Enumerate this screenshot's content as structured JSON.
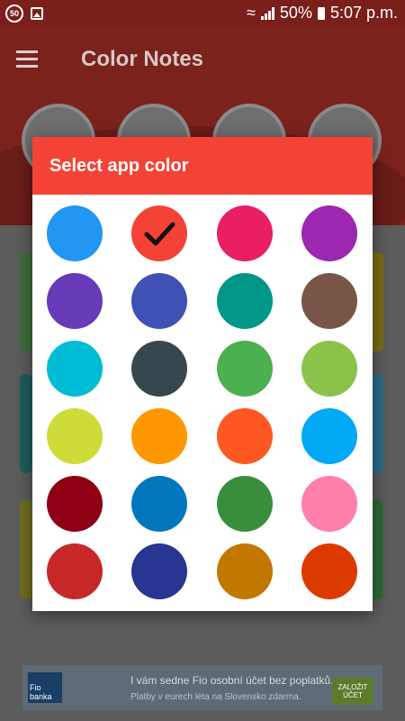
{
  "status_bar": {
    "badge": "50",
    "battery": "50%",
    "time": "5:07 p.m."
  },
  "app": {
    "title": "Color Notes"
  },
  "dialog": {
    "title": "Select app color",
    "selected_index": 1,
    "colors": [
      "#2196f3",
      "#f44336",
      "#e91e63",
      "#9c27b0",
      "#673ab7",
      "#3f51b5",
      "#009688",
      "#795548",
      "#00bcd4",
      "#37474f",
      "#4caf50",
      "#8bc34a",
      "#cddc39",
      "#ff9800",
      "#ff5722",
      "#03a9f4",
      "#8e0014",
      "#0277bd",
      "#388e3c",
      "#ff80ab",
      "#c62828",
      "#283593",
      "#c17700",
      "#dd3a00"
    ]
  },
  "ad": {
    "text": "I vám sedne Fio osobní účet bez poplatků.",
    "subtext": "Platby v eurech léta na Slovensko zdarma.",
    "logo": "Fio banka",
    "button": "ZALOŽIT ÚČET"
  }
}
